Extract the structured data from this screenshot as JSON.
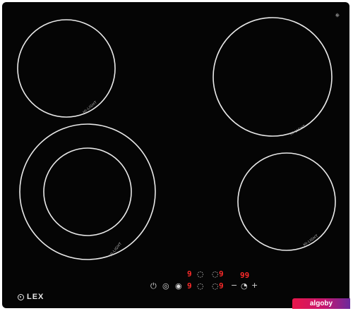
{
  "brand": {
    "name": "LEX"
  },
  "corner_icon": "sensor-icon",
  "zone_label": "HI-LIGHT",
  "controls": {
    "digit_1": "9",
    "digit_2": "9",
    "digit_3": "9",
    "digit_4": "9",
    "timer_display": "99",
    "minus": "−",
    "plus": "+"
  },
  "watermark": "algoby"
}
